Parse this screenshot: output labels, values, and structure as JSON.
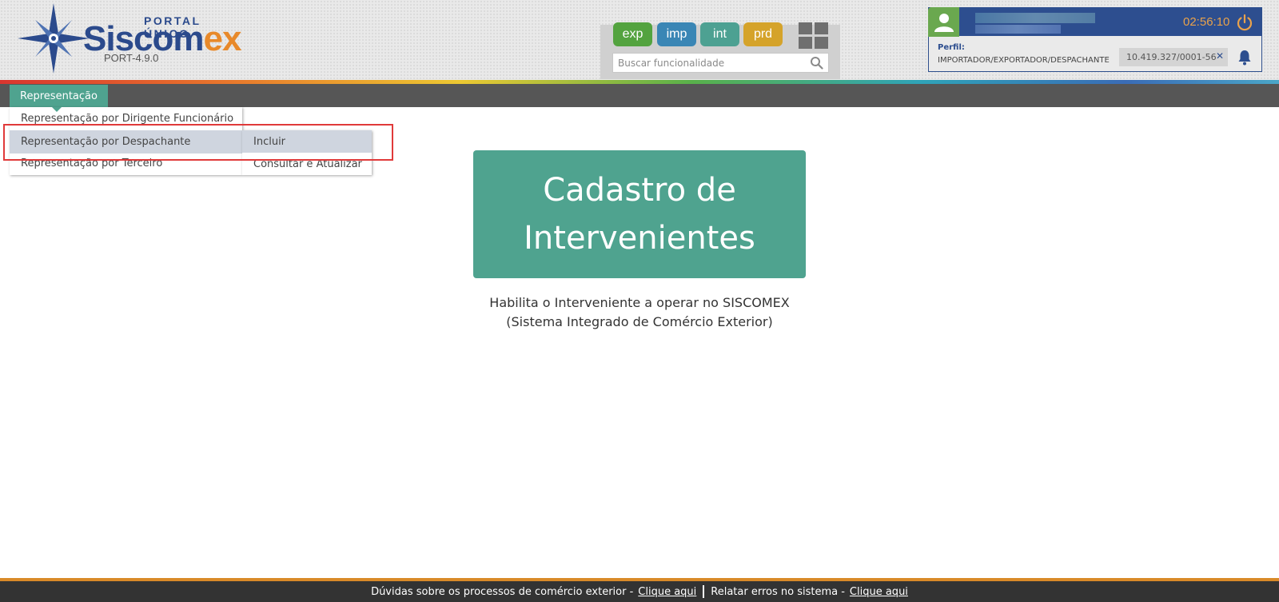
{
  "header": {
    "logo": {
      "portal": "PORTAL ÚNICO",
      "brand_part1": "Siscom",
      "brand_part2": "ex",
      "version": "PORT-4.9.0"
    },
    "environments": [
      {
        "label": "exp",
        "color": "#53a33f"
      },
      {
        "label": "imp",
        "color": "#3a86b5"
      },
      {
        "label": "int",
        "color": "#4da192"
      },
      {
        "label": "prd",
        "color": "#d5a32a"
      }
    ],
    "apps_icon": "grid-icon",
    "search": {
      "placeholder": "Buscar funcionalidade",
      "value": "",
      "icon": "search-icon"
    },
    "user": {
      "timer": "02:56:10",
      "perfil_label": "Perfil:",
      "perfil_value": "IMPORTADOR/EXPORTADOR/DESPACHANTE",
      "cnpj": "10.419.327/0001-56",
      "clear_symbol": "✕",
      "icons": [
        "user-icon",
        "power-icon",
        "bell-icon"
      ]
    }
  },
  "nav": {
    "active_menu": "Representação",
    "dropdown": [
      {
        "label": "Representação por Dirigente Funcionário"
      },
      {
        "label": "Representação por Despachante"
      },
      {
        "label": "Representação por Terceiro"
      }
    ],
    "submenu": [
      {
        "label": "Incluir"
      },
      {
        "label": "Consultar e Atualizar"
      }
    ]
  },
  "main": {
    "hero_line1": "Cadastro de",
    "hero_line2": "Intervenientes",
    "description_line1": "Habilita o Interveniente a operar no SISCOMEX",
    "description_line2": "(Sistema Integrado de Comércio Exterior)"
  },
  "footer": {
    "text1": "Dúvidas sobre os processos de comércio exterior -",
    "link1": "Clique aqui",
    "text2": "Relatar erros no sistema -",
    "link2": "Clique aqui"
  },
  "colors": {
    "accent_green": "#4fa38f",
    "brand_blue": "#2b4a8c",
    "brand_orange": "#e8892a",
    "nav_gray": "#565656",
    "highlight_red": "#e03a3a"
  }
}
